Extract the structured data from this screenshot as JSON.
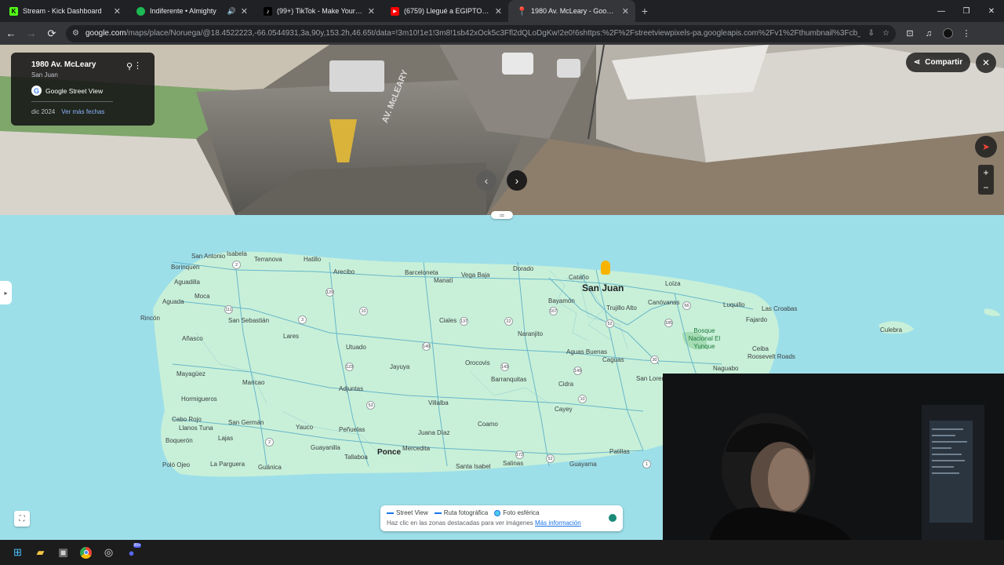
{
  "browser": {
    "tabs": [
      {
        "title": "Stream - Kick Dashboard",
        "favicon_color": "#53fc18",
        "active": false,
        "audio": false
      },
      {
        "title": "Indiferente • Almighty",
        "favicon_color": "#1db954",
        "active": false,
        "audio": true
      },
      {
        "title": "(99+) TikTok - Make Your Day",
        "favicon_color": "#ffffff",
        "active": false,
        "audio": false
      },
      {
        "title": "(6759) Llegué a EGIPTO y todo",
        "favicon_color": "#ff0000",
        "active": false,
        "audio": false
      },
      {
        "title": "1980 Av. McLeary - Google Map",
        "favicon_color": "#34a853",
        "active": true,
        "audio": false
      }
    ],
    "url_host": "google.com",
    "url_path": "/maps/place/Noruega/@18.4522223,-66.0544931,3a,90y,153.2h,46.65t/data=!3m10!1e1!3m8!1sb42xOck5c3Ffl2dQLoDgKw!2e0!6shttps:%2F%2Fstreetviewpixels-pa.googleapis.com%2Fv1%2Fthumbnail%3Fcb_client%3Dmaps_sv.tactil..."
  },
  "streetview": {
    "place_title": "1980 Av. McLeary",
    "place_subtitle": "San Juan",
    "brand": "Google Street View",
    "date": "dic 2024",
    "more_dates": "Ver más fechas",
    "share_label": "Compartir",
    "road_text": "AV. McLEARY"
  },
  "map": {
    "accent": "#9ddfe9",
    "land": "#c8f0d8",
    "cities": [
      {
        "name": "San Antonio"
      },
      {
        "name": "Isabela"
      },
      {
        "name": "Terranova"
      },
      {
        "name": "Hatillo"
      },
      {
        "name": "Borinquen"
      },
      {
        "name": "Aguadilla"
      },
      {
        "name": "Moca"
      },
      {
        "name": "Aguada"
      },
      {
        "name": "Rincón"
      },
      {
        "name": "San Sebastián"
      },
      {
        "name": "Añasco"
      },
      {
        "name": "Mayagüez"
      },
      {
        "name": "Hormigueros"
      },
      {
        "name": "Cabo Rojo"
      },
      {
        "name": "Llanos Tuna"
      },
      {
        "name": "Boquerón"
      },
      {
        "name": "Poló Ojeo"
      },
      {
        "name": "Lares"
      },
      {
        "name": "Maricao"
      },
      {
        "name": "San Germán"
      },
      {
        "name": "Lajas"
      },
      {
        "name": "La Parguera"
      },
      {
        "name": "Guánica"
      },
      {
        "name": "Yauco"
      },
      {
        "name": "Arecibo"
      },
      {
        "name": "Barceloneta"
      },
      {
        "name": "Manatí"
      },
      {
        "name": "Vega Baja"
      },
      {
        "name": "Dorado"
      },
      {
        "name": "Cataño"
      },
      {
        "name": "Bayamón"
      },
      {
        "name": "Loíza"
      },
      {
        "name": "Canóvanas"
      },
      {
        "name": "Luquillo"
      },
      {
        "name": "Las Croabas"
      },
      {
        "name": "Fajardo"
      },
      {
        "name": "Trujillo Alto"
      },
      {
        "name": "Ciales"
      },
      {
        "name": "Naranjito"
      },
      {
        "name": "Utuado"
      },
      {
        "name": "Jayuya"
      },
      {
        "name": "Orocovis"
      },
      {
        "name": "Aguas Buenas"
      },
      {
        "name": "Caguas"
      },
      {
        "name": "Ceiba"
      },
      {
        "name": "Roosevelt Roads"
      },
      {
        "name": "Naguabo"
      },
      {
        "name": "Barranquitas"
      },
      {
        "name": "Cidra"
      },
      {
        "name": "San Lorenzo"
      },
      {
        "name": "Cayey"
      },
      {
        "name": "Adjuntas"
      },
      {
        "name": "Villalba"
      },
      {
        "name": "Peñuelas"
      },
      {
        "name": "Juana Díaz"
      },
      {
        "name": "Coamo"
      },
      {
        "name": "Guayanilla"
      },
      {
        "name": "Tallaboa"
      },
      {
        "name": "Mercedita"
      },
      {
        "name": "Santa Isabel"
      },
      {
        "name": "Salinas"
      },
      {
        "name": "Guayama"
      },
      {
        "name": "Patillas"
      },
      {
        "name": "Culebra"
      }
    ],
    "big_cities": [
      {
        "name": "San Juan"
      },
      {
        "name": "Ponce"
      }
    ],
    "park": "Bosque Nacional El Yunque",
    "routes": [
      "2",
      "111",
      "129",
      "10",
      "149",
      "137",
      "22",
      "167",
      "52",
      "185",
      "66",
      "3",
      "30",
      "2",
      "123",
      "143",
      "149",
      "10",
      "172",
      "52",
      "1",
      "53",
      "3",
      "2",
      "119"
    ]
  },
  "legend": {
    "street_view": "Street View",
    "photo_route": "Ruta fotográfica",
    "spherical": "Foto esférica",
    "hint": "Haz clic en las zonas destacadas para ver imágenes",
    "more_info": "Más información"
  },
  "taskbar": {
    "badge": "99+",
    "apps": [
      "windows-start",
      "file-explorer",
      "task-manager",
      "chrome",
      "obs",
      "discord"
    ]
  }
}
